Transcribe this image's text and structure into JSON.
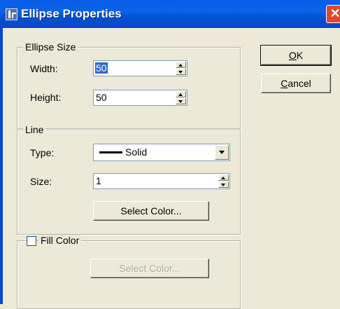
{
  "window": {
    "title": "Ellipse Properties",
    "close_glyph": "✕"
  },
  "ellipse_size": {
    "legend": "Ellipse Size",
    "width_label": "Width:",
    "width_value": "50",
    "height_label": "Height:",
    "height_value": "50"
  },
  "line": {
    "legend": "Line",
    "type_label": "Type:",
    "type_value": "Solid",
    "size_label": "Size:",
    "size_value": "1",
    "select_color_label": "Select Color..."
  },
  "fill": {
    "legend": "Fill Color",
    "checked": false,
    "select_color_label": "Select Color..."
  },
  "buttons": {
    "ok_u": "O",
    "ok_rest": "K",
    "cancel_u": "C",
    "cancel_rest": "ancel"
  },
  "colors": {
    "titlebar": "#0b63e6",
    "dialog_bg": "#ece9d8",
    "selection": "#316ac5"
  }
}
